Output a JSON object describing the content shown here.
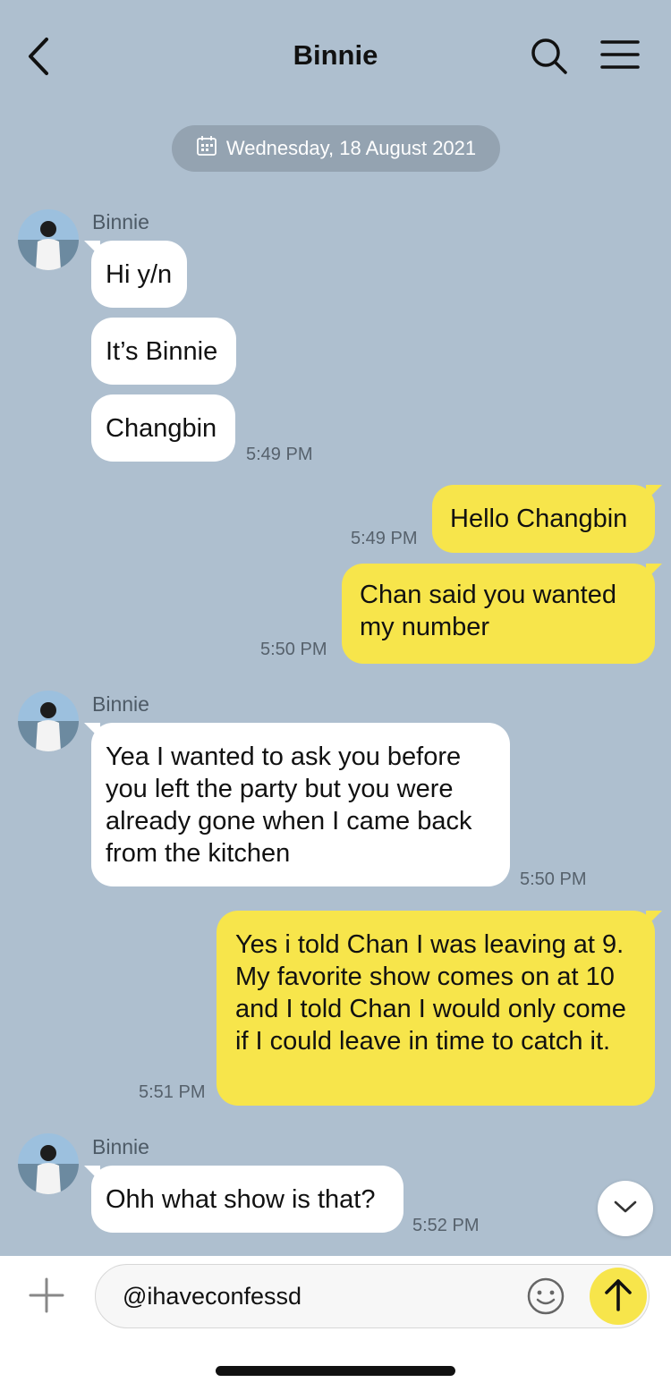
{
  "header": {
    "title": "Binnie"
  },
  "date_separator": "Wednesday, 18 August 2021",
  "messages": [
    {
      "sender": "Binnie",
      "text": "Hi y/n"
    },
    {
      "text": "It’s Binnie"
    },
    {
      "text": "Changbin",
      "time": "5:49 PM"
    },
    {
      "text": "Hello Changbin",
      "time": "5:49 PM"
    },
    {
      "text": "Chan said you wanted my number",
      "time": "5:50 PM"
    },
    {
      "sender": "Binnie",
      "text": "Yea I wanted to ask you before you left the party but you were already gone when I came back from the kitchen",
      "time": "5:50 PM"
    },
    {
      "text": "Yes i told Chan I was leaving at 9. My favorite show comes on at 10 and I told Chan I would only come if I could leave in time to catch it.",
      "time": "5:51 PM"
    },
    {
      "sender": "Binnie",
      "text": "Ohh what show is that?",
      "time": "5:52 PM"
    }
  ],
  "composer": {
    "value": "@ihaveconfessd"
  },
  "colors": {
    "background": "#aebfcf",
    "outgoing": "#f7e54b",
    "incoming": "#ffffff"
  }
}
